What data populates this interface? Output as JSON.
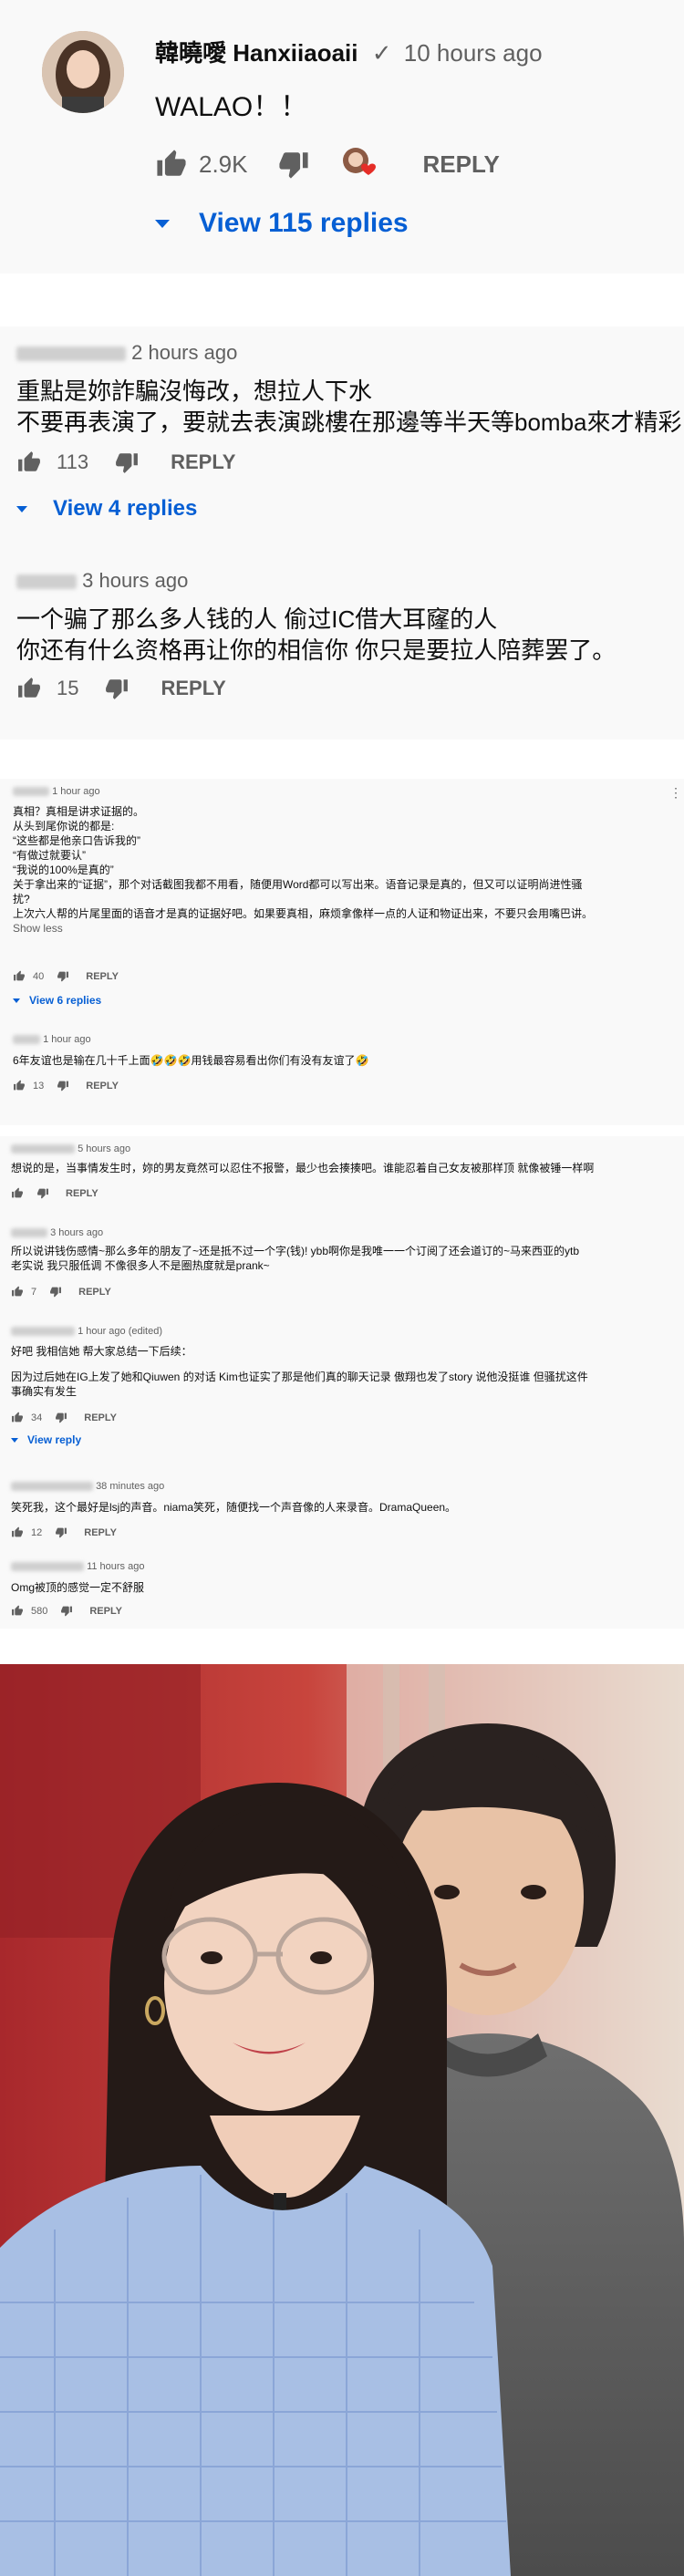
{
  "thread1": {
    "author": "韓曉噯 Hanxiiaoaii",
    "time": "10 hours ago",
    "text": "WALAO！！",
    "likes": "2.9K",
    "reply": "REPLY",
    "view_replies": "View 115 replies"
  },
  "thread2": {
    "c1": {
      "time": "2 hours ago",
      "lines": [
        "重點是妳詐騙沒悔改，想拉人下水",
        "不要再表演了，要就去表演跳樓在那邊等半天等bomba來才精彩"
      ],
      "likes": "113",
      "reply": "REPLY",
      "view_replies": "View 4 replies"
    },
    "c2": {
      "time": "3 hours ago",
      "lines": [
        "一个骗了那么多人钱的人 偷过IC借大耳窿的人",
        "你还有什么资格再让你的相信你 你只是要拉人陪葬罢了。"
      ],
      "likes": "15",
      "reply": "REPLY"
    }
  },
  "thread3": {
    "c1": {
      "time": "1 hour ago",
      "lines": [
        "真相？真相是讲求证据的。",
        "从头到尾你说的都是:",
        "“这些都是他亲口告诉我的”",
        "“有做过就要认”",
        "“我说的100%是真的”",
        "关于拿出来的“证据”，那个对话截图我都不用看，随便用Word都可以写出来。语音记录是真的，但又可以证明尚进性骚",
        "扰?",
        "上次六人帮的片尾里面的语音才是真的证据好吧。如果要真相，麻烦拿像样一点的人证和物证出来，不要只会用嘴巴讲。"
      ],
      "show_less": "Show less",
      "likes": "40",
      "reply": "REPLY",
      "view_replies": "View 6 replies"
    },
    "c2": {
      "time": "1 hour ago",
      "text": "6年友谊也是输在几十千上面🤣🤣🤣用钱最容易看出你们有没有友谊了🤣",
      "likes": "13",
      "reply": "REPLY"
    }
  },
  "thread4": {
    "c1": {
      "time": "5 hours ago",
      "text": "想说的是，当事情发生时，妳的男友竟然可以忍住不报警，最少也会揍揍吧。谁能忍着自己女友被那样顶 就像被锤一样啊",
      "reply": "REPLY"
    },
    "c2": {
      "time": "3 hours ago",
      "lines": [
        "所以说讲钱伤感情~那么多年的朋友了~还是抵不过一个字(钱)! ybb啊你是我唯一一个订阅了还会道订的~马来西亚的ytb",
        "老实说 我只服低调 不像很多人不是圈热度就是prank~"
      ],
      "likes": "7",
      "reply": "REPLY"
    },
    "c3": {
      "time": "1 hour ago (edited)",
      "lines": [
        "好吧 我相信她 帮大家总结一下后续：",
        "",
        "因为过后她在IG上发了她和Qiuwen 的对话 Kim也证实了那是他们真的聊天记录 傲翔也发了story 说他没挺谁 但骚扰这件",
        "事确实有发生"
      ],
      "likes": "34",
      "reply": "REPLY",
      "view_reply": "View reply"
    },
    "c4": {
      "time": "38 minutes ago",
      "text": "笑死我，这个最好是lsj的声音。niama笑死，随便找一个声音像的人来录音。DramaQueen。",
      "likes": "12",
      "reply": "REPLY"
    },
    "c5": {
      "time": "11 hours ago",
      "text": "Omg被顶的感觉一定不舒服",
      "likes": "580",
      "reply": "REPLY"
    }
  },
  "colors": {
    "link": "#065fd4",
    "meta": "#606060",
    "panel": "#f9f9f9"
  }
}
